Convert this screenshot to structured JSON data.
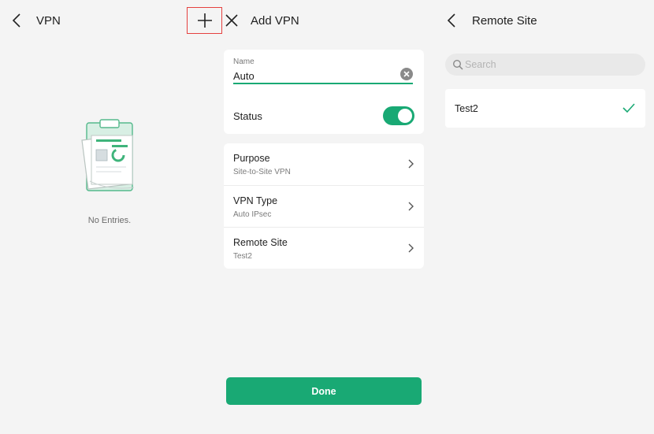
{
  "vpn_list": {
    "title": "VPN",
    "empty_text": "No Entries."
  },
  "add_vpn": {
    "title": "Add VPN",
    "name": {
      "label": "Name",
      "value": "Auto"
    },
    "status": {
      "label": "Status",
      "enabled": true
    },
    "rows": [
      {
        "title": "Purpose",
        "value": "Site-to-Site VPN"
      },
      {
        "title": "VPN Type",
        "value": "Auto IPsec"
      },
      {
        "title": "Remote Site",
        "value": "Test2"
      }
    ],
    "done_label": "Done"
  },
  "remote_site": {
    "title": "Remote Site",
    "search_placeholder": "Search",
    "items": [
      {
        "name": "Test2",
        "selected": true
      }
    ]
  },
  "colors": {
    "accent": "#19a974",
    "highlight": "#e5413f",
    "background": "#f4f4f4"
  },
  "icons": [
    "back-icon",
    "plus-icon",
    "close-icon",
    "clear-icon",
    "chevron-right-icon",
    "search-icon",
    "check-icon",
    "clipboard-illustration"
  ]
}
